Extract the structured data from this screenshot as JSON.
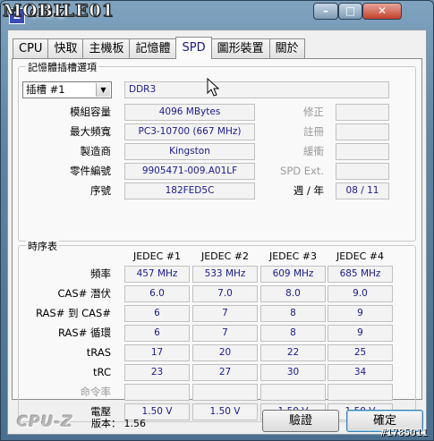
{
  "window": {
    "title": "CPU-Z",
    "watermark": "MOBILE01",
    "image_id": "#1785011"
  },
  "tabs": [
    "CPU",
    "快取",
    "主機板",
    "記憶體",
    "SPD",
    "圖形裝置",
    "關於"
  ],
  "active_tab": 4,
  "slot_group": {
    "title": "記憶體插槽選項",
    "slot_selected": "插槽 #1",
    "memory_type": "DDR3",
    "rows_left": [
      {
        "label": "模組容量",
        "value": "4096 MBytes"
      },
      {
        "label": "最大頻寬",
        "value": "PC3-10700 (667 MHz)"
      },
      {
        "label": "製造商",
        "value": "Kingston"
      },
      {
        "label": "零件編號",
        "value": "9905471-009.A01LF"
      },
      {
        "label": "序號",
        "value": "182FED5C"
      }
    ],
    "rows_right": [
      {
        "label": "修正",
        "value": ""
      },
      {
        "label": "註冊",
        "value": ""
      },
      {
        "label": "緩衝",
        "value": ""
      },
      {
        "label": "SPD Ext.",
        "value": ""
      }
    ],
    "week_year_label": "週 / 年",
    "week_year_value": "08 / 11"
  },
  "timing_group": {
    "title": "時序表",
    "columns": [
      "JEDEC #1",
      "JEDEC #2",
      "JEDEC #3",
      "JEDEC #4"
    ],
    "rows": [
      {
        "label": "頻率",
        "values": [
          "457 MHz",
          "533 MHz",
          "609 MHz",
          "685 MHz"
        ],
        "dim": false
      },
      {
        "label": "CAS# 潛伏",
        "values": [
          "6.0",
          "7.0",
          "8.0",
          "9.0"
        ],
        "dim": false
      },
      {
        "label": "RAS# 到 CAS#",
        "values": [
          "6",
          "7",
          "8",
          "9"
        ],
        "dim": false
      },
      {
        "label": "RAS# 循環",
        "values": [
          "6",
          "7",
          "8",
          "9"
        ],
        "dim": false
      },
      {
        "label": "tRAS",
        "values": [
          "17",
          "20",
          "22",
          "25"
        ],
        "dim": false
      },
      {
        "label": "tRC",
        "values": [
          "23",
          "27",
          "30",
          "34"
        ],
        "dim": false
      },
      {
        "label": "命令率",
        "values": [
          "",
          "",
          "",
          ""
        ],
        "dim": true
      },
      {
        "label": "電壓",
        "values": [
          "1.50 V",
          "1.50 V",
          "1.50 V",
          "1.50 V"
        ],
        "dim": false
      }
    ]
  },
  "footer": {
    "logo": "CPU-Z",
    "version_label": "版本：",
    "version_value": "1.56",
    "validate_label": "驗證",
    "ok_label": "確定"
  },
  "colors": {
    "value_text": "#1a1a8c",
    "panel_bg": "#f9f9f9"
  }
}
